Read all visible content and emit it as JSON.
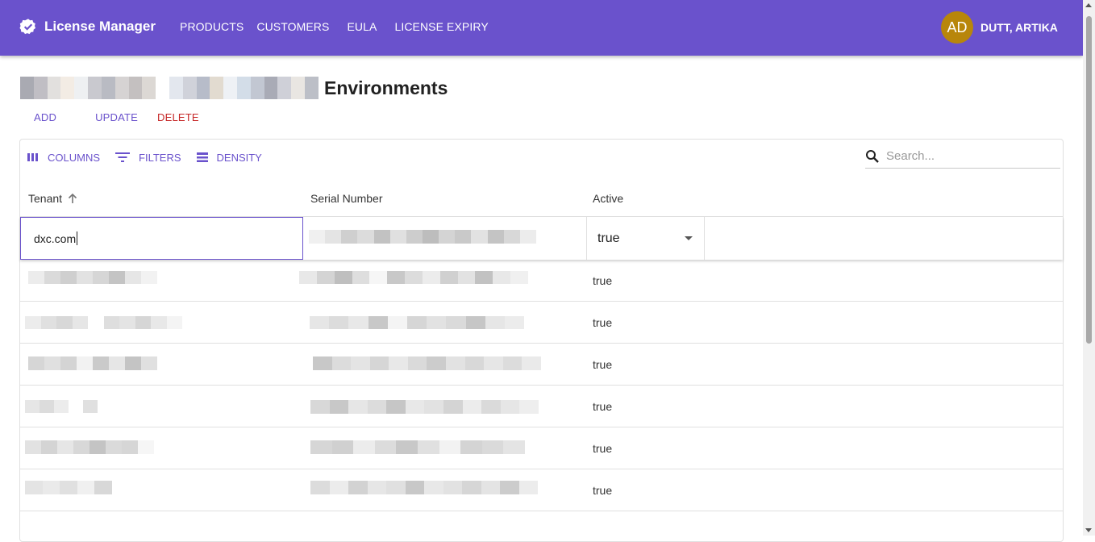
{
  "app": {
    "title": "License Manager",
    "nav": [
      "PRODUCTS",
      "CUSTOMERS",
      "EULA",
      "LICENSE EXPIRY"
    ],
    "user": {
      "initials": "AD",
      "name": "DUTT, ARTIKA"
    }
  },
  "page": {
    "title": "Environments",
    "actions": {
      "add": "ADD",
      "update": "UPDATE",
      "delete": "DELETE"
    }
  },
  "toolbar": {
    "columns": "COLUMNS",
    "filters": "FILTERS",
    "density": "DENSITY",
    "search_placeholder": "Search..."
  },
  "table": {
    "columns": [
      "Tenant",
      "Serial Number",
      "Active"
    ],
    "sort": {
      "column": "Tenant",
      "direction": "ascending"
    },
    "edit_row": {
      "tenant": "dxc.com",
      "active": "true"
    },
    "rows": [
      {
        "active": "true"
      },
      {
        "active": "true"
      },
      {
        "active": "true"
      },
      {
        "active": "true"
      },
      {
        "active": "true"
      },
      {
        "active": "true"
      }
    ]
  },
  "colors": {
    "primary": "#6a52cc",
    "danger": "#c62828",
    "avatar": "#b8860b"
  }
}
